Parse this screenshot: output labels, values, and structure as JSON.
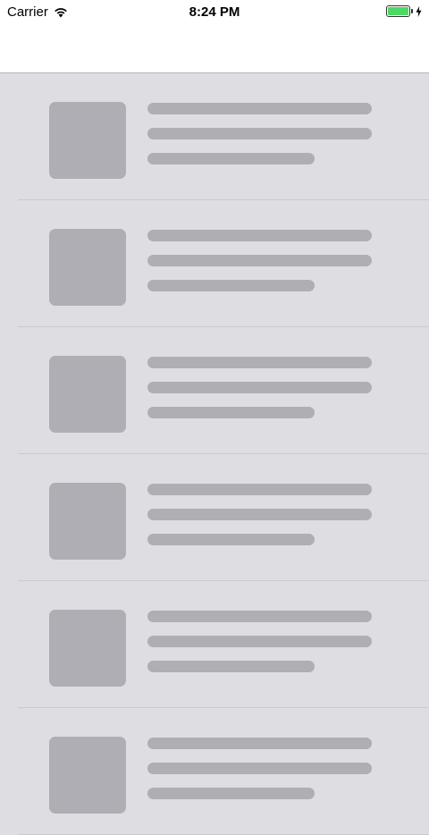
{
  "status_bar": {
    "carrier": "Carrier",
    "time": "8:24 PM",
    "battery_icon": "battery-icon",
    "charging_icon": "bolt-icon",
    "wifi_icon": "wifi-icon",
    "battery_color": "#4cd964"
  },
  "list": {
    "placeholder_color": "#afaeb4",
    "background_color": "#dedde2",
    "rows": [
      {
        "kind": "skeleton"
      },
      {
        "kind": "skeleton"
      },
      {
        "kind": "skeleton"
      },
      {
        "kind": "skeleton"
      },
      {
        "kind": "skeleton"
      },
      {
        "kind": "skeleton"
      }
    ]
  }
}
